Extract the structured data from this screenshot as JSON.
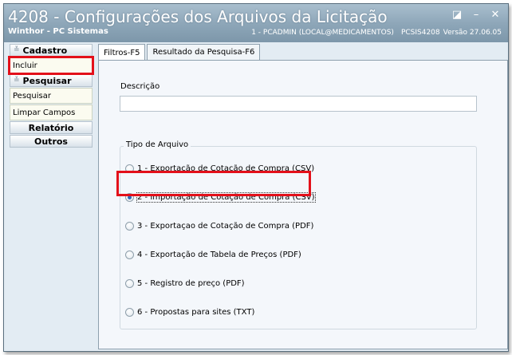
{
  "window": {
    "title": "4208 - Configurações dos Arquivos da Licitação",
    "subtitle": "Winthor - PC Sistemas",
    "user_info": "1 - PCADMIN (LOCAL@MEDICAMENTOS)",
    "routine": "PCSIS4208",
    "version": "Versão 27.06.05",
    "controls": {
      "restore": "◪",
      "minimize": "–",
      "close": "✕"
    }
  },
  "sidebar": {
    "sections": [
      {
        "label": "Cadastro",
        "items": [
          "Incluir"
        ]
      },
      {
        "label": "Pesquisar",
        "items": [
          "Pesquisar",
          "Limpar Campos"
        ]
      },
      {
        "label": "Relatório",
        "items": []
      },
      {
        "label": "Outros",
        "items": []
      }
    ]
  },
  "tabs": [
    {
      "label": "Filtros-F5",
      "active": true
    },
    {
      "label": "Resultado da Pesquisa-F6",
      "active": false
    }
  ],
  "form": {
    "description_label": "Descrição",
    "description_value": "",
    "file_type_label": "Tipo de Arquivo",
    "file_type_options": [
      "1 - Exportação de Cotação de Compra (CSV)",
      "2 - Importação de Cotação de Compra (CSV)",
      "3 - Exportaçao de Cotação de Compra (PDF)",
      "4 - Exportação de Tabela de Preços (PDF)",
      "5 - Registro de preço (PDF)",
      "6 - Propostas para sites (TXT)"
    ],
    "selected_option": 1
  },
  "colors": {
    "highlight": "#e3101a",
    "titlebar": "#8ea7b9",
    "background": "#e3ecf3"
  }
}
